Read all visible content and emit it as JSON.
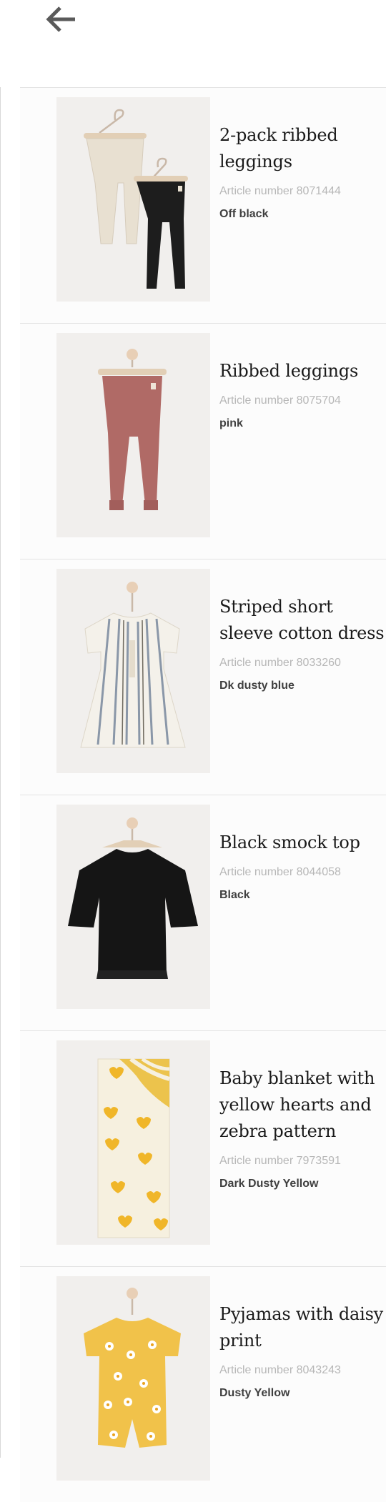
{
  "header": {
    "back_icon": "arrow-left-icon"
  },
  "products": [
    {
      "name": "2-pack ribbed leggings",
      "article_label": "Article number",
      "article_number": "8071444",
      "article_text": "Article number 8071444",
      "color": "Off black",
      "image": "leggings-2pack-image"
    },
    {
      "name": "Ribbed leggings",
      "article_label": "Article number",
      "article_number": "8075704",
      "article_text": "Article number 8075704",
      "color": "pink",
      "image": "pink-leggings-image"
    },
    {
      "name": "Striped short sleeve cotton dress",
      "article_label": "Article number",
      "article_number": "8033260",
      "article_text": "Article number 8033260",
      "color": "Dk dusty blue",
      "image": "striped-dress-image"
    },
    {
      "name": "Black smock top",
      "article_label": "Article number",
      "article_number": "8044058",
      "article_text": "Article number 8044058",
      "color": "Black",
      "image": "black-top-image"
    },
    {
      "name": "Baby blanket with yellow hearts and zebra pattern",
      "article_label": "Article number",
      "article_number": "7973591",
      "article_text": "Article number 7973591",
      "color": "Dark Dusty Yellow",
      "image": "baby-blanket-image"
    },
    {
      "name": "Pyjamas with daisy print",
      "article_label": "Article number",
      "article_number": "8043243",
      "article_text": "Article number 8043243",
      "color": "Dusty Yellow",
      "image": "daisy-pyjamas-image"
    }
  ],
  "colors": {
    "name_text": "#1a1a1a",
    "article_text": "#b7b7b7",
    "color_text": "#3f3f3f",
    "divider": "#e3e3e3",
    "thumb_bg": "#f1efed"
  }
}
